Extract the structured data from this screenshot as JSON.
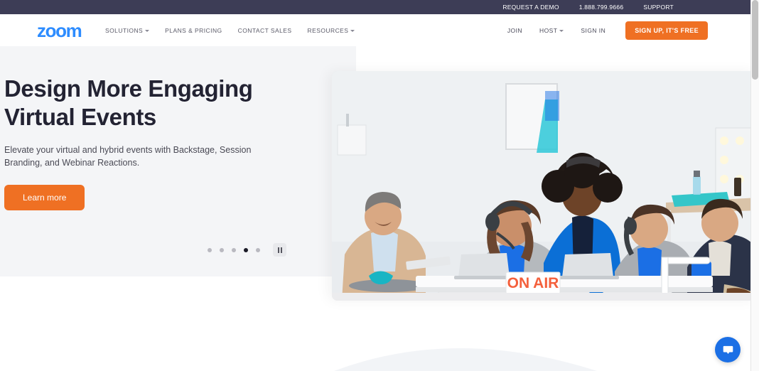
{
  "utility_bar": {
    "links": [
      {
        "label": "REQUEST A DEMO"
      },
      {
        "label": "1.888.799.9666"
      },
      {
        "label": "SUPPORT"
      }
    ]
  },
  "nav": {
    "logo": "zoom",
    "left_items": [
      {
        "label": "SOLUTIONS",
        "has_caret": true
      },
      {
        "label": "PLANS & PRICING",
        "has_caret": false
      },
      {
        "label": "CONTACT SALES",
        "has_caret": false
      },
      {
        "label": "RESOURCES",
        "has_caret": true
      }
    ],
    "right_items": [
      {
        "label": "JOIN",
        "has_caret": false
      },
      {
        "label": "HOST",
        "has_caret": true
      },
      {
        "label": "SIGN IN",
        "has_caret": false
      }
    ],
    "signup_label": "SIGN UP, IT'S FREE"
  },
  "hero": {
    "title_line1": "Design More Engaging",
    "title_line2": "Virtual Events",
    "subtitle": "Elevate your virtual and hybrid events with Backstage, Session Branding, and Webinar Reactions.",
    "cta_label": "Learn more",
    "image_alt_text": "ON AIR",
    "carousel": {
      "slide_count": 5,
      "active_index": 3,
      "playing": true
    }
  },
  "colors": {
    "brand_blue": "#2d8cff",
    "accent_orange": "#ef7023",
    "utility_bar_bg": "#3d3d56",
    "hero_panel_bg": "#f4f5f7",
    "heading_text": "#232333",
    "chat_blue": "#1b6fe5"
  }
}
